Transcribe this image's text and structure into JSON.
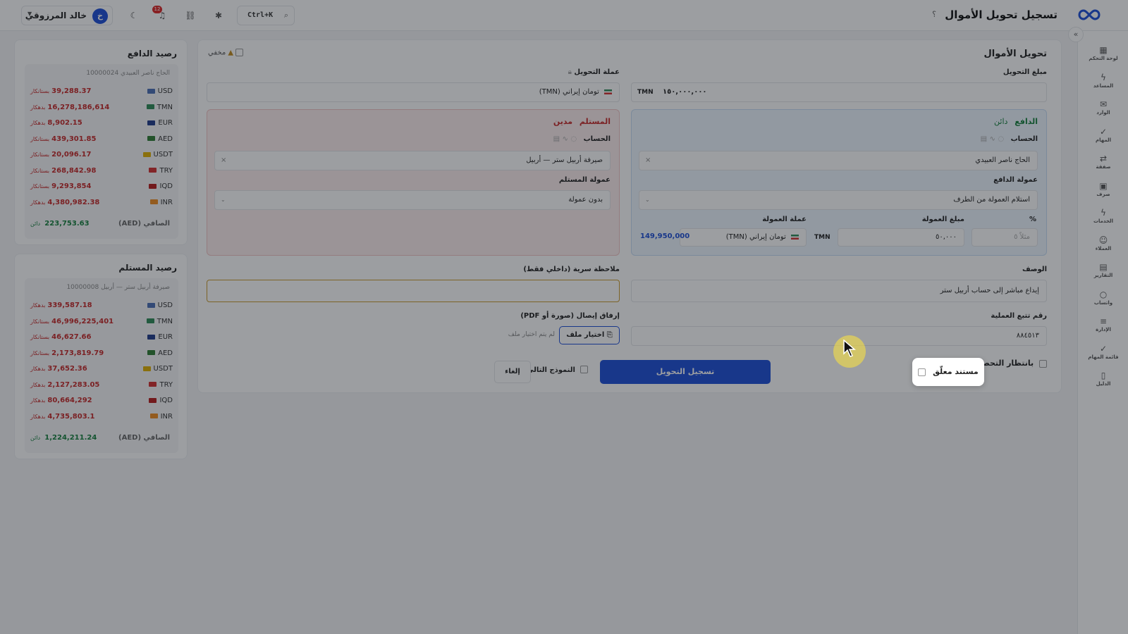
{
  "header": {
    "title": "تسجيل تحويل الأموال",
    "help": "؟",
    "search_shortcut": "Ctrl+K",
    "notifications_count": "12",
    "user": {
      "initial": "خ",
      "name": "خالد المرزوقي"
    }
  },
  "sidebar": {
    "collapse": "«",
    "items": [
      {
        "label": "لوحة التحكم",
        "icon": "dashboard-icon",
        "glyph": "▦"
      },
      {
        "label": "المساعد",
        "icon": "bolt-icon",
        "glyph": "ϟ"
      },
      {
        "label": "الوارد",
        "icon": "inbox-icon",
        "glyph": "✉"
      },
      {
        "label": "المهام",
        "icon": "check-icon",
        "glyph": "✓"
      },
      {
        "label": "صفقة",
        "icon": "exchange-icon",
        "glyph": "⇄"
      },
      {
        "label": "صرف",
        "icon": "cash-icon",
        "glyph": "▣"
      },
      {
        "label": "الخدمات",
        "icon": "bolt-icon",
        "glyph": "ϟ"
      },
      {
        "label": "العملاء",
        "icon": "users-icon",
        "glyph": "☺"
      },
      {
        "label": "التقارير",
        "icon": "report-icon",
        "glyph": "▤"
      },
      {
        "label": "واتساب",
        "icon": "chat-icon",
        "glyph": "○"
      },
      {
        "label": "الإدارة",
        "icon": "sliders-icon",
        "glyph": "≡"
      },
      {
        "label": "قائمة المهام",
        "icon": "checklist-icon",
        "glyph": "✓"
      },
      {
        "label": "الدليل",
        "icon": "book-icon",
        "glyph": "▯"
      }
    ]
  },
  "form": {
    "title": "تحويل الأموال",
    "hidden_label": "مخفي",
    "amount_label": "مبلغ التحويل",
    "amount_value": "١٥٠,٠٠٠,٠٠٠",
    "amount_currency": "TMN",
    "currency_label": "عملة التحويل",
    "currency_value": "تومان إيراني (TMN)",
    "payer": {
      "title": "الدافع",
      "tag": "دائن",
      "account_label": "الحساب",
      "account_value": "الحاج ناصر العبيدي",
      "commission_label": "عمولة الدافع",
      "commission_value": "استلام العمولة من الطرف",
      "percent_label": "%",
      "percent_placeholder": "مثلاً ٥",
      "commission_amount_label": "مبلغ العمولة",
      "commission_amount_value": "٥٠,٠٠٠",
      "commission_amount_currency": "TMN",
      "commission_currency_label": "عملة العمولة",
      "commission_currency_value": "تومان إيراني (TMN)",
      "net_value": "149,950,000"
    },
    "receiver": {
      "title": "المستلم",
      "tag": "مدين",
      "account_label": "الحساب",
      "account_value": "صيرفة أربيل ستر — أربيل",
      "commission_label": "عمولة المستلم",
      "commission_value": "بدون عمولة"
    },
    "description_label": "الوصف",
    "description_value": "إيداع مباشر إلى حساب أربيل ستر",
    "secret_note_label": "ملاحظة سرية (داخلي فقط)",
    "tracking_label": "رقم تتبع العملية",
    "tracking_value": "٨٨٤٥١٣",
    "attach_label": "إرفاق إيصال (صورة أو PDF)",
    "choose_file": "اختيار ملف",
    "no_file": "لم يتم اختيار ملف",
    "pending_collection": "بانتظار التحصيل",
    "pending_document": "مستند معلّق",
    "submit": "تسجيل التحويل",
    "next_form": "النموذج التالي",
    "cancel": "إلغاء"
  },
  "payer_balance": {
    "title": "رصيد الدافع",
    "account": "الحاج ناصر العبيدي 10000024",
    "rows": [
      {
        "cur": "USD",
        "val": "39,288.37",
        "tag": "بستانكار",
        "flag": "#4a6fb5"
      },
      {
        "cur": "TMN",
        "val": "16,278,186,614",
        "tag": "بدهكار",
        "flag": "#2e8b57"
      },
      {
        "cur": "EUR",
        "val": "8,902.15",
        "tag": "بدهكار",
        "flag": "#1f3b8a"
      },
      {
        "cur": "AED",
        "val": "439,301.85",
        "tag": "بستانكار",
        "flag": "#2e7d32"
      },
      {
        "cur": "USDT",
        "val": "20,096.17",
        "tag": "بستانكار",
        "flag": "#e0b000"
      },
      {
        "cur": "TRY",
        "val": "268,842.98",
        "tag": "بستانكار",
        "flag": "#d32f2f"
      },
      {
        "cur": "IQD",
        "val": "9,293,854",
        "tag": "بستانكار",
        "flag": "#b71c1c"
      },
      {
        "cur": "INR",
        "val": "4,380,982.38",
        "tag": "بدهكار",
        "flag": "#ef8c1f"
      }
    ],
    "net_label": "الصافي (AED)",
    "net_value": "223,753.63",
    "net_tag": "دائن"
  },
  "receiver_balance": {
    "title": "رصيد المستلم",
    "account": "صيرفة أربيل ستر — أربيل 10000008",
    "rows": [
      {
        "cur": "USD",
        "val": "339,587.18",
        "tag": "بدهكار",
        "flag": "#4a6fb5"
      },
      {
        "cur": "TMN",
        "val": "46,996,225,401",
        "tag": "بستانكار",
        "flag": "#2e8b57"
      },
      {
        "cur": "EUR",
        "val": "46,627.66",
        "tag": "بستانكار",
        "flag": "#1f3b8a"
      },
      {
        "cur": "AED",
        "val": "2,173,819.79",
        "tag": "بستانكار",
        "flag": "#2e7d32"
      },
      {
        "cur": "USDT",
        "val": "37,652.36",
        "tag": "بدهكار",
        "flag": "#e0b000"
      },
      {
        "cur": "TRY",
        "val": "2,127,283.05",
        "tag": "بدهكار",
        "flag": "#d32f2f"
      },
      {
        "cur": "IQD",
        "val": "80,664,292",
        "tag": "بدهكار",
        "flag": "#b71c1c"
      },
      {
        "cur": "INR",
        "val": "4,735,803.1",
        "tag": "بدهكار",
        "flag": "#ef8c1f"
      }
    ],
    "net_label": "الصافي (AED)",
    "net_value": "1,224,211.24",
    "net_tag": "دائن"
  },
  "colors": {
    "accent": "#1d4ed8",
    "credit": "#15803d",
    "debit": "#c62828",
    "overlay": "#141820"
  }
}
